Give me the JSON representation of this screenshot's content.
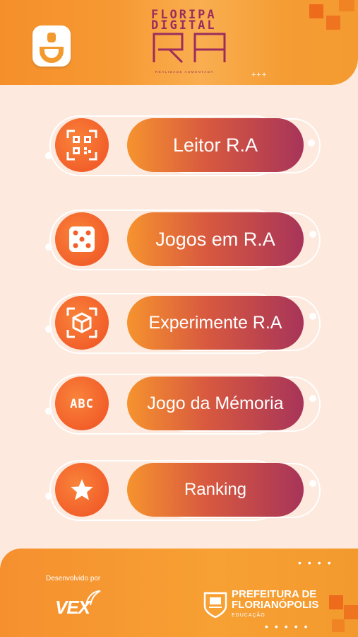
{
  "header": {
    "logo": {
      "line1": "FLORIPA",
      "line2": "DIGITAL",
      "mark": "RA",
      "tagline": "REALIDADE AUMENTADA"
    },
    "profile_icon": "user-profile-icon"
  },
  "menu": [
    {
      "label": "Leitor R.A",
      "icon": "qr-code-icon"
    },
    {
      "label": "Jogos em R.A",
      "icon": "dice-icon"
    },
    {
      "label": "Experimente R.A",
      "icon": "ar-cube-icon"
    },
    {
      "label": "Jogo da Mémoria",
      "icon": "abc-icon"
    },
    {
      "label": "Ranking",
      "icon": "star-icon"
    }
  ],
  "footer": {
    "developed_by": "Desenvolvido por",
    "developer": "VEX",
    "institution_line1": "PREFEITURA DE",
    "institution_line2": "FLORIANÓPOLIS",
    "institution_line3": "EDUCAÇÃO"
  },
  "colors": {
    "accent_orange": "#f58f2a",
    "accent_red": "#f25f2a",
    "accent_purple": "#a73459",
    "background": "#fde9dd"
  }
}
